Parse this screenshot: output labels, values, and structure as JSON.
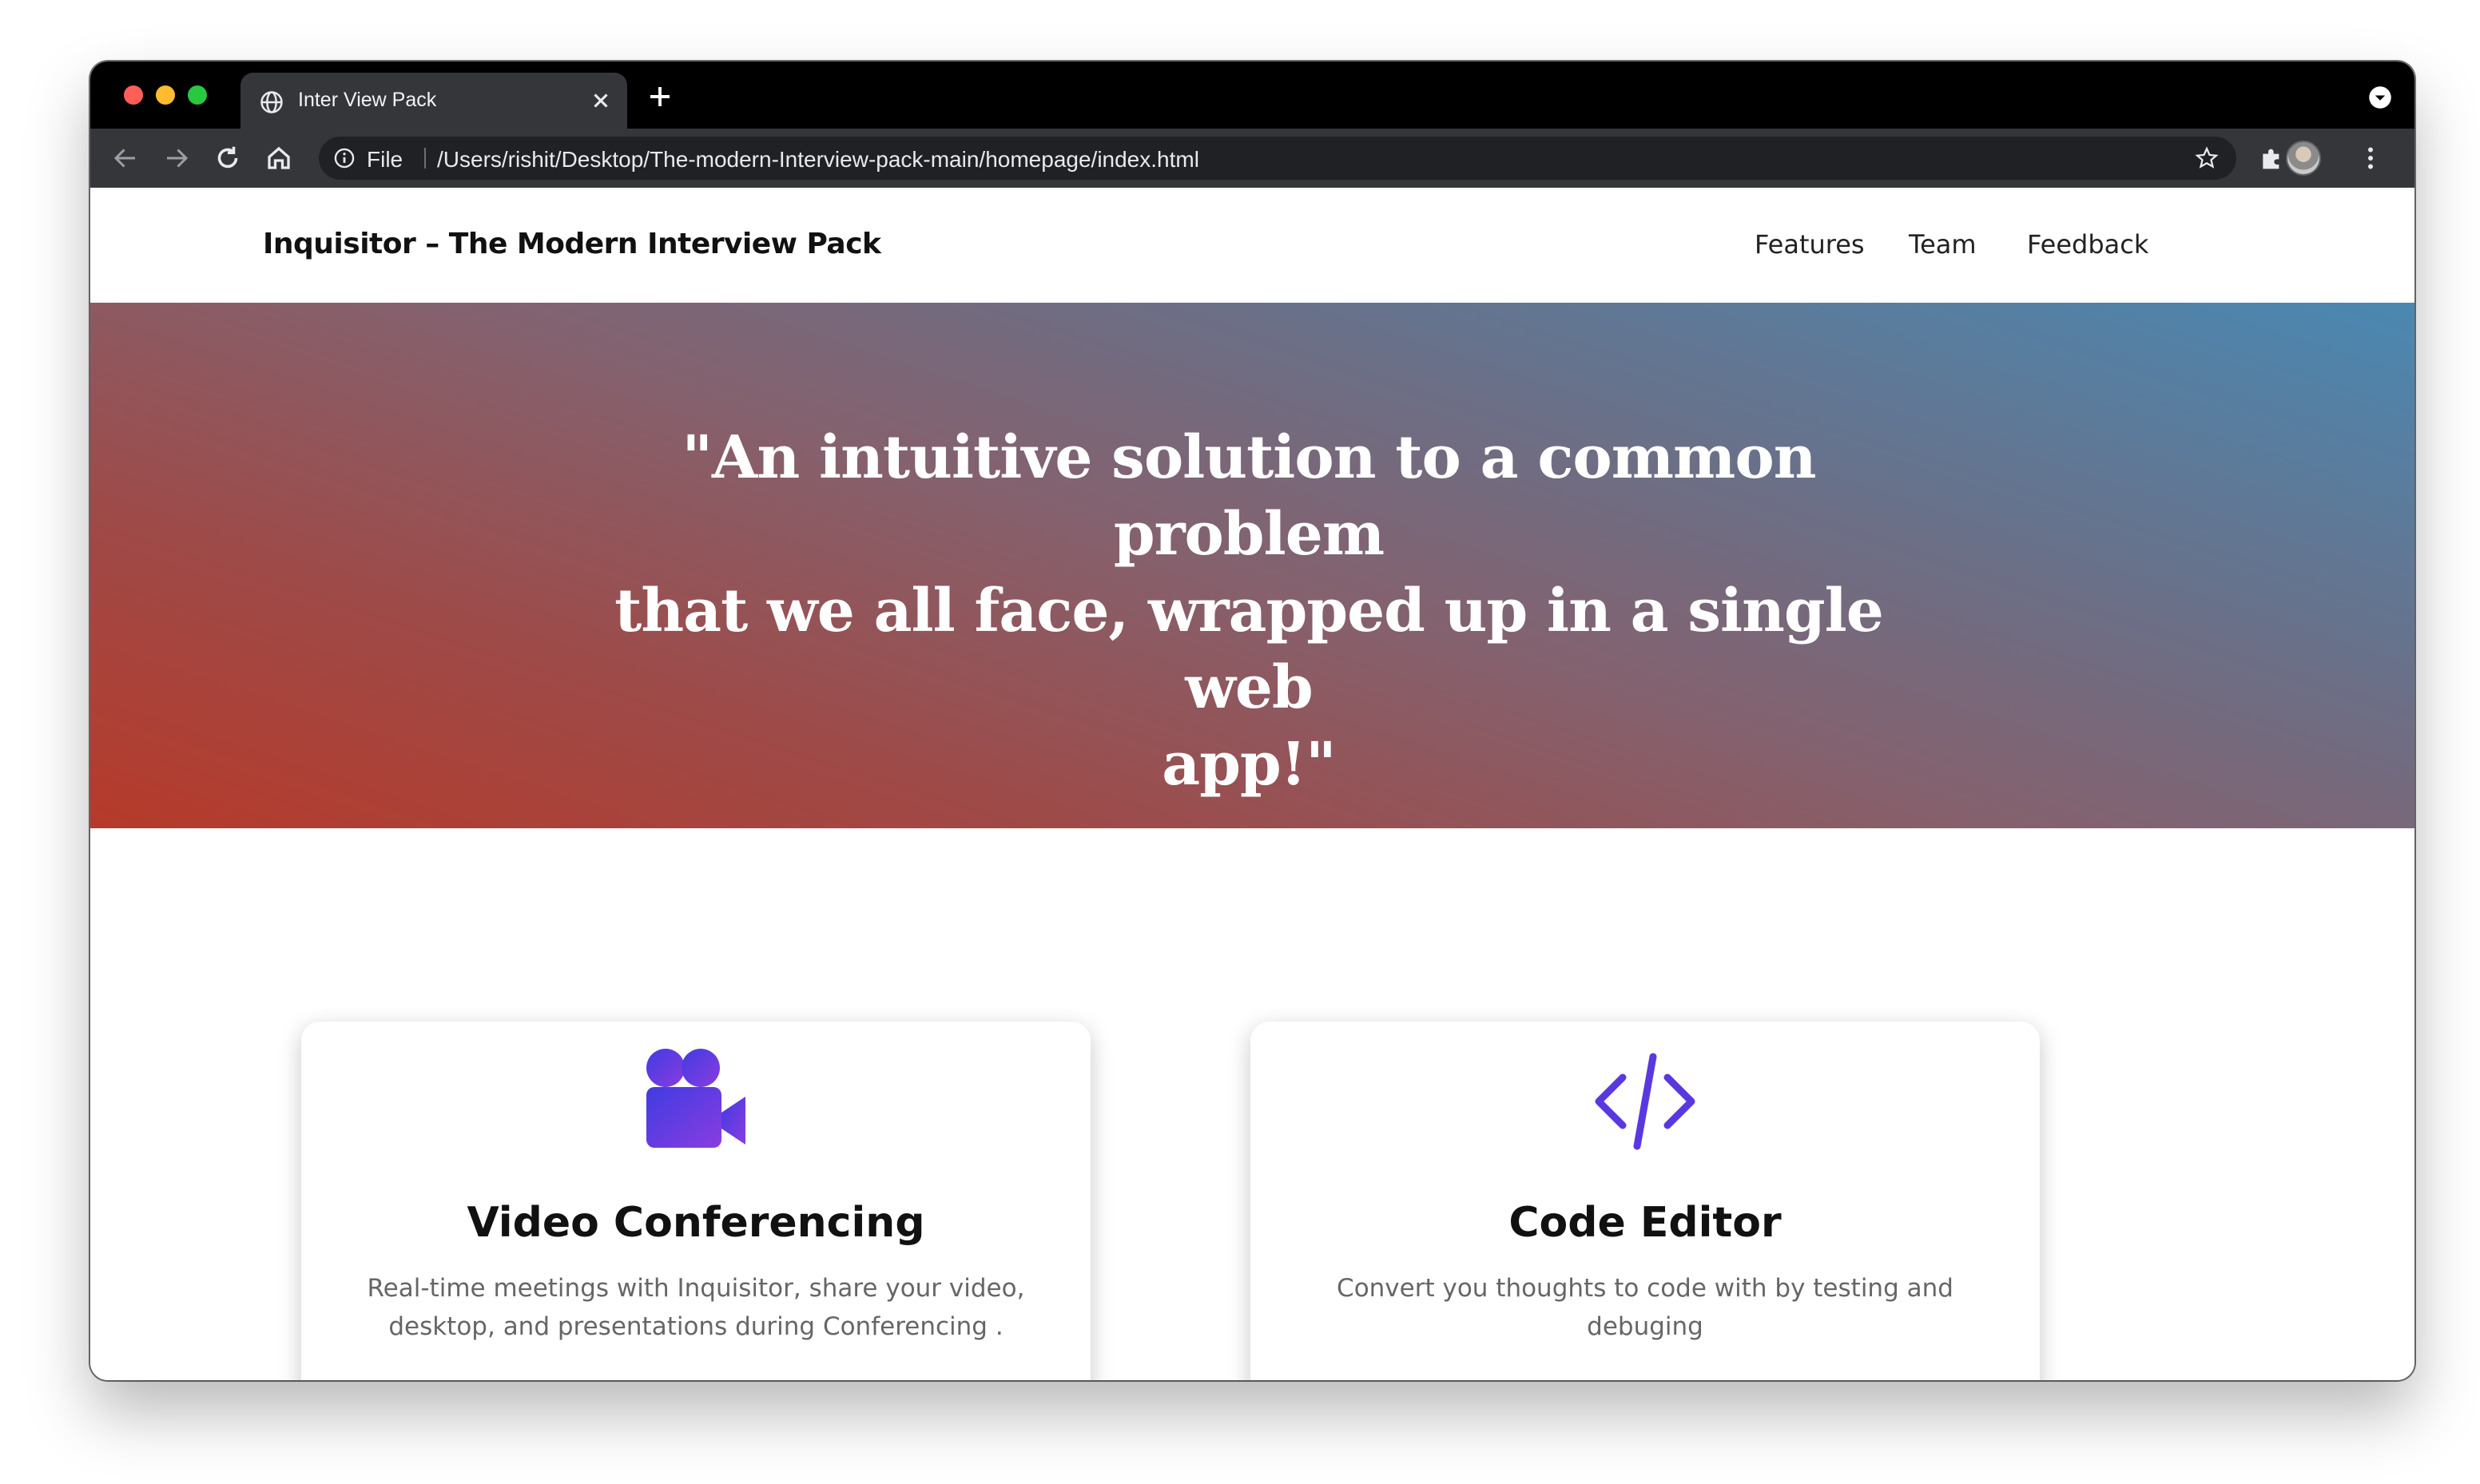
{
  "browser": {
    "tab_title": "Inter View Pack",
    "address_scheme": "File",
    "address_url": "/Users/rishit/Desktop/The-modern-Interview-pack-main/homepage/index.html"
  },
  "navbar": {
    "brand": "Inquisitor – The Modern Interview Pack",
    "links": [
      "Features",
      "Team",
      "Feedback"
    ]
  },
  "hero": {
    "quote_lines": [
      "\"An intuitive solution to a common problem",
      "that we all face, wrapped up in a single web",
      "app!\""
    ],
    "gradient_colors": [
      "#b63a2a",
      "#4a88b2"
    ]
  },
  "features": [
    {
      "icon": "video-camera-icon",
      "title": "Video Conferencing",
      "description": "Real-time meetings with Inquisitor, share your video, desktop, and presentations during Conferencing ."
    },
    {
      "icon": "code-icon",
      "title": "Code Editor",
      "description": "Convert you thoughts to code with by testing and debuging"
    }
  ],
  "colors": {
    "accent_purple": "#6d3be0",
    "accent_blue": "#4a38e0"
  }
}
